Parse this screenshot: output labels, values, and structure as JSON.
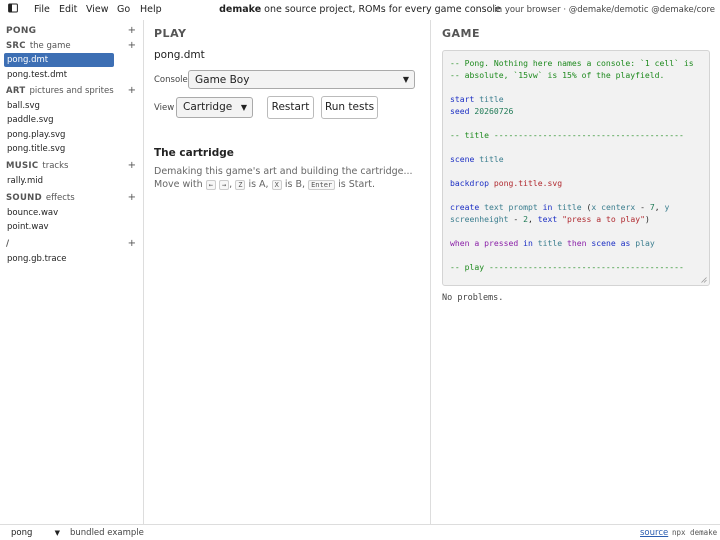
{
  "topbar": {
    "menu": [
      "File",
      "Edit",
      "View",
      "Go",
      "Help"
    ],
    "brand": "demake",
    "tagline": "one source project, ROMs for every game console",
    "right": "in your browser · @demake/demotic @demake/core"
  },
  "sidebar": {
    "project": "PONG",
    "plus": "+",
    "sections": [
      {
        "title": "SRC",
        "subtitle": "the game",
        "files": [
          "pong.dmt",
          "pong.test.dmt"
        ]
      },
      {
        "title": "ART",
        "subtitle": "pictures and sprites",
        "files": [
          "ball.svg",
          "paddle.svg",
          "pong.play.svg",
          "pong.title.svg"
        ]
      },
      {
        "title": "MUSIC",
        "subtitle": "tracks",
        "files": [
          "rally.mid"
        ]
      },
      {
        "title": "SOUND",
        "subtitle": "effects",
        "files": [
          "bounce.wav",
          "point.wav"
        ]
      },
      {
        "title": "/",
        "subtitle": "",
        "files": [
          "pong.gb.trace"
        ]
      }
    ],
    "selected_file": "pong.dmt"
  },
  "play": {
    "title": "PLAY",
    "file": "pong.dmt",
    "console_label": "Console",
    "console_value": "Game Boy",
    "view_label": "View",
    "view_value": "Cartridge",
    "restart_label": "Restart",
    "run_tests_label": "Run tests",
    "cartridge_title": "The cartridge",
    "cartridge_text": "Demaking this game's art and building the cartridge...",
    "move_with": "Move with",
    "keys": {
      "left": "←",
      "right": "→",
      "z": "Z",
      "x": "X",
      "enter": "Enter"
    },
    "is_a": "is A,",
    "is_b": "is B,",
    "is_start": "is Start."
  },
  "game": {
    "title": "GAME",
    "code": [
      "-- Pong. Nothing here names a console: `1 cell` is",
      "-- absolute, `15vw` is 15% of the playfield.",
      "start title",
      "seed 20260726",
      "-- title ---------------------------------------",
      "scene title",
      "backdrop pong.title.svg",
      "create text prompt in title (x centerx - 7, y",
      "screenheight - 2, text \"press a to play\")",
      "when a pressed in title then scene as play",
      "-- play ----------------------------------------"
    ],
    "problems": "No problems."
  },
  "statusbar": {
    "project": "pong",
    "bundled": "bundled example",
    "source": "source",
    "npx": "npx demake"
  }
}
